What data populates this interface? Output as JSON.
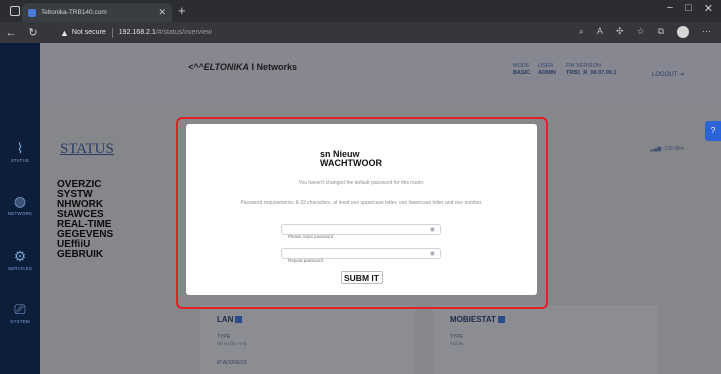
{
  "browser": {
    "tab_title": "Teltonika-TRB140.com",
    "not_secure": "Not secure",
    "url_host": "192.168.2.1",
    "url_path": "/#/status/overview"
  },
  "header": {
    "logo_brand": "<^^ELTONIKA",
    "logo_rest": " I Networks",
    "mode_label": "MODE",
    "mode_value": "BASIC",
    "user_label": "USER",
    "user_value": "ADMIN",
    "fw_label": "FW VERSION",
    "fw_value": "TRB1_R_00.07.00.1",
    "logout": "LOGOUT"
  },
  "sidebar": {
    "items": [
      {
        "label": "STATUS",
        "icon": "pulse-icon"
      },
      {
        "label": "NETWORK",
        "icon": "globe-icon"
      },
      {
        "label": "SERVICES",
        "icon": "gear-icon"
      },
      {
        "label": "SYSTEM",
        "icon": "system-icon"
      }
    ]
  },
  "page": {
    "title": "STATUS",
    "menu": [
      "OVERZIC",
      "SYSTW",
      "NHWORK",
      "StAWCES",
      "REAL-TIME",
      "GEGEVENS",
      "UEffiiU",
      "GEBRUIK"
    ],
    "signal": "-100 dBm",
    "lan_title": "LAN",
    "lan_type_label": "TYPE",
    "lan_type_value": "Wired (Ex-Ant)",
    "lan_ip_label": "IP ADDRESS",
    "mobile_title": "MOBIESTAT",
    "mobile_type_label": "TYPE",
    "mobile_type_value": "Mobile"
  },
  "modal": {
    "title": "sn Nieuw WACHTWOOR",
    "message": "You haven't changed the default password for this router.",
    "requirements": "Password requirements: 8-32 characters, at least one uppercase letter, one lowercase letter and one number.",
    "new_password_placeholder": "Please input password",
    "repeat_password_placeholder": "Repeat password",
    "submit_label": "SUBM IT"
  },
  "colors": {
    "sidebar_bg": "#0d1e3a",
    "accent": "#2a64d6",
    "highlight": "#e31e24"
  }
}
